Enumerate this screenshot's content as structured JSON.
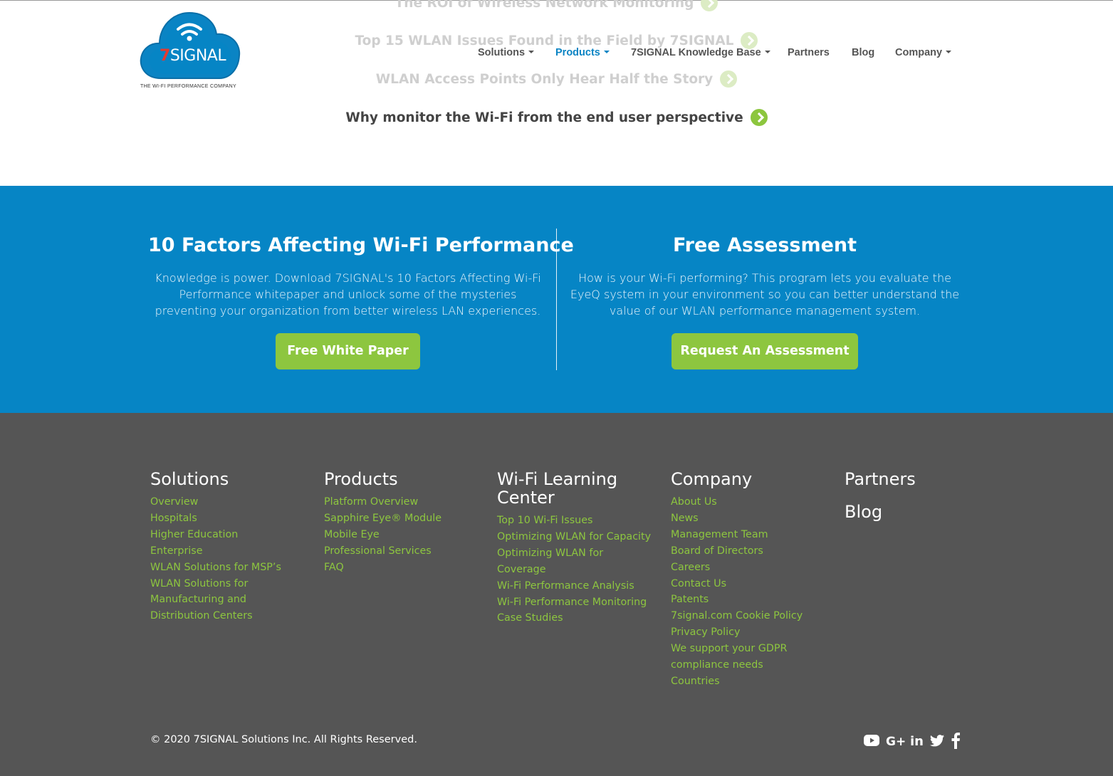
{
  "header": {
    "logo_text": "7SIGNAL",
    "logo_tagline": "THE WI-FI PERFORMANCE COMPANY",
    "nav": [
      {
        "label": "Solutions",
        "dropdown": true
      },
      {
        "label": "Products",
        "dropdown": true,
        "active": true
      },
      {
        "label": "7SIGNAL Knowledge Base",
        "dropdown": true
      },
      {
        "label": "Partners",
        "dropdown": false
      },
      {
        "label": "Blog",
        "dropdown": false
      },
      {
        "label": "Company",
        "dropdown": true
      }
    ]
  },
  "articles": [
    {
      "label": "The ROI of Wireless Network Monitoring"
    },
    {
      "label": "Top 15 WLAN Issues Found in the Field by 7SIGNAL"
    },
    {
      "label": "WLAN Access Points Only Hear Half the Story"
    },
    {
      "label": "Why monitor the Wi-Fi from the end user perspective"
    }
  ],
  "cta": {
    "left": {
      "title": "10 Factors Affecting Wi-Fi Performance",
      "text": "Knowledge is power. Download 7SIGNAL's 10 Factors Affecting Wi-Fi Performance whitepaper and unlock some of the mysteries preventing your organization from better wireless LAN experiences.",
      "button": "Free White Paper"
    },
    "right": {
      "title": "Free Assessment",
      "text": "How is your Wi-Fi performing? This program lets you evaluate the EyeQ system in your environment so you can better understand the value of our WLAN performance management system.",
      "button": "Request An Assessment"
    }
  },
  "footer": {
    "columns": [
      {
        "heading": "Solutions",
        "links": [
          "Overview",
          "Hospitals",
          "Higher Education",
          "Enterprise",
          "WLAN Solutions for MSP’s",
          "WLAN Solutions for Manufacturing and Distribution Centers"
        ]
      },
      {
        "heading": "Products",
        "links": [
          "Platform Overview",
          "Sapphire Eye® Module",
          "Mobile Eye",
          "Professional Services",
          "FAQ"
        ]
      },
      {
        "heading": "Wi-Fi Learning Center",
        "links": [
          "Top 10 Wi-Fi Issues",
          "Optimizing WLAN for Capacity",
          "Optimizing WLAN for Coverage",
          "Wi-Fi Performance Analysis",
          "Wi-Fi Performance Monitoring",
          "Case Studies"
        ]
      },
      {
        "heading": "Company",
        "links": [
          "About Us",
          "News",
          "Management Team",
          "Board of Directors",
          "Careers",
          "Contact Us",
          "Patents",
          "7signal.com Cookie Policy",
          "Privacy Policy",
          "We support your GDPR compliance needs",
          "Countries"
        ]
      }
    ],
    "extra_headings": [
      "Partners",
      "Blog"
    ],
    "copyright": "© 2020 7SIGNAL Solutions Inc. All Rights Reserved.",
    "social_icons": [
      "youtube-icon",
      "google-plus-icon",
      "linkedin-icon",
      "twitter-icon",
      "facebook-icon"
    ]
  },
  "colors": {
    "brand_blue": "#0685c5",
    "brand_green": "#8dc63f",
    "footer_bg": "#555555",
    "logo_red": "#e53a2f"
  }
}
